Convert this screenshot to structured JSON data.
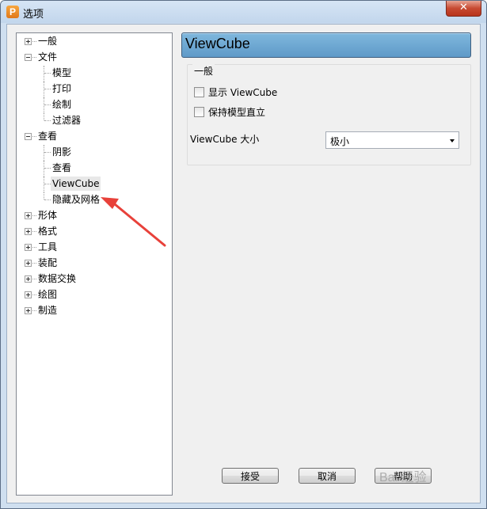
{
  "window": {
    "title": "选项",
    "app_icon_letter": "P",
    "close_glyph": "✕"
  },
  "tree": {
    "items": [
      {
        "label": "一般",
        "level": 0,
        "expander": "plus"
      },
      {
        "label": "文件",
        "level": 0,
        "expander": "minus"
      },
      {
        "label": "模型",
        "level": 1
      },
      {
        "label": "打印",
        "level": 1
      },
      {
        "label": "绘制",
        "level": 1
      },
      {
        "label": "过滤器",
        "level": 1
      },
      {
        "label": "查看",
        "level": 0,
        "expander": "minus"
      },
      {
        "label": "阴影",
        "level": 1
      },
      {
        "label": "查看",
        "level": 1
      },
      {
        "label": "ViewCube",
        "level": 1,
        "selected": true
      },
      {
        "label": "隐藏及网格",
        "level": 1
      },
      {
        "label": "形体",
        "level": 0,
        "expander": "plus"
      },
      {
        "label": "格式",
        "level": 0,
        "expander": "plus"
      },
      {
        "label": "工具",
        "level": 0,
        "expander": "plus"
      },
      {
        "label": "装配",
        "level": 0,
        "expander": "plus"
      },
      {
        "label": "数据交换",
        "level": 0,
        "expander": "plus"
      },
      {
        "label": "绘图",
        "level": 0,
        "expander": "plus"
      },
      {
        "label": "制造",
        "level": 0,
        "expander": "plus"
      }
    ]
  },
  "panel": {
    "header": "ViewCube",
    "group_title": "一般",
    "show_viewcube": {
      "label": "显示 ViewCube",
      "checked": false
    },
    "keep_upright": {
      "label": "保持模型直立",
      "checked": false
    },
    "size_label": "ViewCube 大小",
    "size_value": "极小"
  },
  "buttons": {
    "accept": "接受",
    "cancel": "取消",
    "help": "帮助"
  },
  "annotation": {
    "arrow_color": "#e8413a"
  },
  "watermark": "Bai 经验"
}
